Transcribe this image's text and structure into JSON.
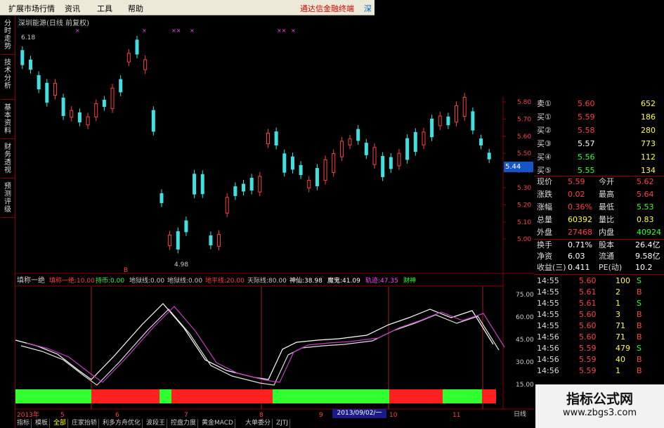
{
  "menu": {
    "items": [
      "扩展市场行情",
      "资讯",
      "工具",
      "帮助"
    ],
    "brand": "通达信金融终端",
    "brand2": "深"
  },
  "left_tabs": [
    "分时走势",
    "技术分析",
    "基本资料",
    "财务透视",
    "预测评级"
  ],
  "stock": {
    "title": "深圳能源(日线 前复权)",
    "high_label": "6.18",
    "low_label": "4.98",
    "last_price_tag": "5.44",
    "marker_letter": "B",
    "top_markers": [
      "×",
      "×",
      "××",
      "×",
      "××",
      "×"
    ]
  },
  "price_axis": [
    "5.80",
    "5.70",
    "5.60",
    "5.50",
    "5.40",
    "5.30",
    "5.20",
    "5.10",
    "5.00"
  ],
  "indicator": {
    "name": "填称一绝",
    "params": [
      {
        "label": "填称一绝:",
        "value": "10.00",
        "color": "#ff4040"
      },
      {
        "label": "持币:",
        "value": "0.00",
        "color": "#30ff30"
      },
      {
        "label": "地狱线:",
        "value": "0.00",
        "color": "#cccccc"
      },
      {
        "label": "地狱线:",
        "value": "0.00",
        "color": "#cccccc"
      },
      {
        "label": "地平线:",
        "value": "20.00",
        "color": "#ff4040"
      },
      {
        "label": "天际线:",
        "value": "80.00",
        "color": "#cccccc"
      },
      {
        "label": "神仙:",
        "value": "38.98",
        "color": "#ffffff"
      },
      {
        "label": "魔鬼:",
        "value": "41.09",
        "color": "#ffffff"
      },
      {
        "label": "轨迹:",
        "value": "47.35",
        "color": "#ff40ff"
      },
      {
        "label": "财神",
        "value": "",
        "color": "#30ff30"
      }
    ],
    "axis": [
      "75.00",
      "60.00",
      "45.00",
      "30.00",
      "15.00"
    ]
  },
  "x_axis": {
    "labels": [
      "2013年",
      "5",
      "6",
      "7",
      "8",
      "9",
      "10",
      "11"
    ],
    "date_box": "2013/09/02/一",
    "right_label": "日线"
  },
  "bottom_tabs": [
    "指标",
    "模板",
    "全部",
    "庄家抬轿",
    "利多方舟优化",
    "波段王",
    "控盘力度",
    "黄金MACD",
    "大单委分",
    "ZJTJ"
  ],
  "orderbook": [
    {
      "label": "卖①",
      "price": "5.60",
      "vol": "652",
      "pcolor": "#ff4040"
    },
    {
      "label": "买①",
      "price": "5.59",
      "vol": "186",
      "pcolor": "#ff4040"
    },
    {
      "label": "买②",
      "price": "5.58",
      "vol": "280",
      "pcolor": "#ff4040"
    },
    {
      "label": "买③",
      "price": "5.57",
      "vol": "773",
      "pcolor": "#ffffff"
    },
    {
      "label": "买④",
      "price": "5.56",
      "vol": "112",
      "pcolor": "#30ff30"
    },
    {
      "label": "买⑤",
      "price": "5.55",
      "vol": "134",
      "pcolor": "#30ff30"
    }
  ],
  "stats": [
    {
      "l1": "现价",
      "v1": "5.59",
      "c1": "#ff4040",
      "l2": "今开",
      "v2": "5.62",
      "c2": "#ff4040"
    },
    {
      "l1": "涨跌",
      "v1": "0.02",
      "c1": "#ff4040",
      "l2": "最高",
      "v2": "5.64",
      "c2": "#ff4040"
    },
    {
      "l1": "涨幅",
      "v1": "0.36%",
      "c1": "#ff4040",
      "l2": "最低",
      "v2": "5.53",
      "c2": "#30ff30"
    },
    {
      "l1": "总量",
      "v1": "60392",
      "c1": "#ffff40",
      "l2": "量比",
      "v2": "0.83",
      "c2": "#ffff40"
    },
    {
      "l1": "外盘",
      "v1": "27468",
      "c1": "#ff4040",
      "l2": "内盘",
      "v2": "40924",
      "c2": "#30ff30"
    }
  ],
  "stats2": [
    {
      "l1": "换手",
      "v1": "0.71%",
      "l2": "股本",
      "v2": "26.4亿"
    },
    {
      "l1": "净资",
      "v1": "6.03",
      "l2": "流通",
      "v2": "9.58亿"
    },
    {
      "l1": "收益(三)",
      "v1": "0.411",
      "l2": "PE(动)",
      "v2": "10.2"
    }
  ],
  "ticks": [
    {
      "t": "14:55",
      "p": "5.60",
      "pc": "#ff4040",
      "v": "100",
      "d": "S",
      "dc": "#30ff30"
    },
    {
      "t": "14:55",
      "p": "5.61",
      "pc": "#ff4040",
      "v": "2",
      "d": "B",
      "dc": "#ff4040"
    },
    {
      "t": "14:55",
      "p": "5.61",
      "pc": "#ff4040",
      "v": "1",
      "d": "S",
      "dc": "#30ff30"
    },
    {
      "t": "14:55",
      "p": "5.60",
      "pc": "#ff4040",
      "v": "3",
      "d": "B",
      "dc": "#ff4040"
    },
    {
      "t": "14:55",
      "p": "5.60",
      "pc": "#ff4040",
      "v": "71",
      "d": "B",
      "dc": "#ff4040"
    },
    {
      "t": "14:56",
      "p": "5.60",
      "pc": "#ff4040",
      "v": "71",
      "d": "B",
      "dc": "#ff4040"
    },
    {
      "t": "14:56",
      "p": "5.59",
      "pc": "#ff4040",
      "v": "479",
      "d": "S",
      "dc": "#30ff30"
    },
    {
      "t": "14:56",
      "p": "5.59",
      "pc": "#ff4040",
      "v": "40",
      "d": "B",
      "dc": "#ff4040"
    },
    {
      "t": "14:56",
      "p": "5.59",
      "pc": "#ff4040",
      "v": "1",
      "d": "B",
      "dc": "#ff4040"
    }
  ],
  "watermark": {
    "line1": "指标公式网",
    "line2": "www.zbgs3.com"
  }
}
